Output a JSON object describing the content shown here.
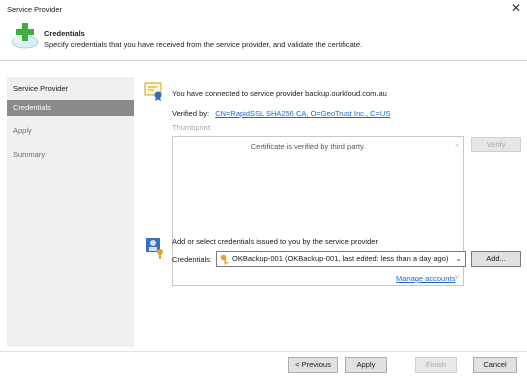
{
  "window": {
    "title": "Service Provider",
    "close_glyph": "✕"
  },
  "header": {
    "title": "Credentials",
    "description": "Specify credentials that you have received from the service provider, and validate the certificate.",
    "icon": "cloud-plus-icon"
  },
  "sidebar": {
    "items": [
      {
        "label": "Service Provider",
        "state": "normal"
      },
      {
        "label": "Credentials",
        "state": "active"
      },
      {
        "label": "Apply",
        "state": "dim"
      },
      {
        "label": "Summary",
        "state": "dim"
      }
    ]
  },
  "certificate": {
    "connected_text": "You have connected to service provider backup.ourkloud.com.au",
    "verified_by_label": "Verified by:",
    "verified_by_value": "CN=RapidSSL SHA256 CA, O=GeoTrust Inc., C=US",
    "thumbprint_label": "Thumbprint:",
    "thumbprint_text": "Certificate is verified by third party.",
    "verify_button": "Verify"
  },
  "credentials": {
    "prompt": "Add or select credentials issued to you by the service provider",
    "label": "Credentials:",
    "selected_value": "OKBackup-001 (OKBackup-001, last edited: less than a day ago)",
    "add_button": "Add...",
    "manage_link": "Manage accounts"
  },
  "footer": {
    "previous": "< Previous",
    "apply": "Apply",
    "finish": "Finish",
    "cancel": "Cancel"
  },
  "colors": {
    "accent_link": "#1f66c9",
    "active_nav": "#8a8a8a",
    "sidebar_bg": "#f0f0f0"
  }
}
